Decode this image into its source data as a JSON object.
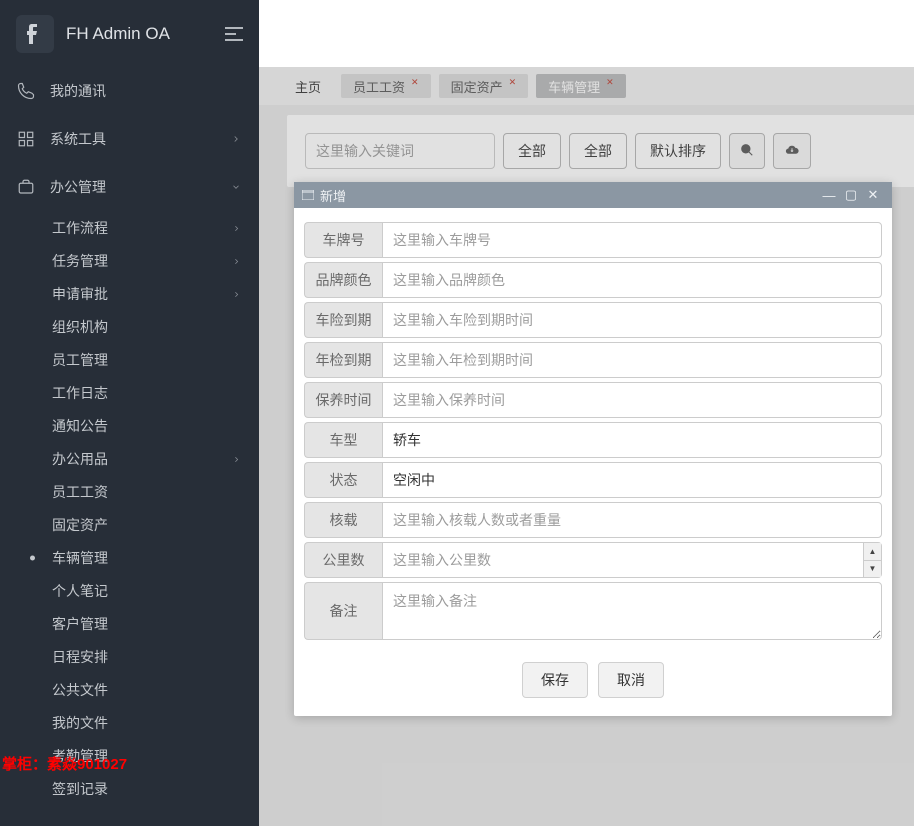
{
  "header": {
    "title": "FH Admin OA"
  },
  "sidebar": {
    "top": [
      {
        "icon": "phone",
        "label": "我的通讯",
        "expandable": false
      },
      {
        "icon": "grid",
        "label": "系统工具",
        "expandable": true,
        "expanded": false
      },
      {
        "icon": "briefcase",
        "label": "办公管理",
        "expandable": true,
        "expanded": true
      }
    ],
    "sub": [
      {
        "label": "工作流程",
        "expandable": true
      },
      {
        "label": "任务管理",
        "expandable": true
      },
      {
        "label": "申请审批",
        "expandable": true
      },
      {
        "label": "组织机构"
      },
      {
        "label": "员工管理"
      },
      {
        "label": "工作日志"
      },
      {
        "label": "通知公告"
      },
      {
        "label": "办公用品",
        "expandable": true
      },
      {
        "label": "员工工资"
      },
      {
        "label": "固定资产"
      },
      {
        "label": "车辆管理",
        "active": true
      },
      {
        "label": "个人笔记"
      },
      {
        "label": "客户管理"
      },
      {
        "label": "日程安排"
      },
      {
        "label": "公共文件"
      },
      {
        "label": "我的文件"
      },
      {
        "label": "考勤管理"
      },
      {
        "label": "签到记录"
      }
    ]
  },
  "watermark": "掌柜：素焱901027",
  "tabs": {
    "home": "主页",
    "items": [
      {
        "label": "员工工资"
      },
      {
        "label": "固定资产"
      },
      {
        "label": "车辆管理",
        "active": true
      }
    ]
  },
  "toolbar": {
    "keyword_placeholder": "这里输入关键词",
    "filter1": "全部",
    "filter2": "全部",
    "sort": "默认排序"
  },
  "dialog": {
    "title": "新增",
    "fields": {
      "plate": {
        "label": "车牌号",
        "placeholder": "这里输入车牌号"
      },
      "brandcol": {
        "label": "品牌颜色",
        "placeholder": "这里输入品牌颜色"
      },
      "insur": {
        "label": "车险到期",
        "placeholder": "这里输入车险到期时间"
      },
      "inspect": {
        "label": "年检到期",
        "placeholder": "这里输入年检到期时间"
      },
      "maint": {
        "label": "保养时间",
        "placeholder": "这里输入保养时间"
      },
      "type": {
        "label": "车型",
        "value": "轿车"
      },
      "status": {
        "label": "状态",
        "value": "空闲中"
      },
      "capacity": {
        "label": "核载",
        "placeholder": "这里输入核载人数或者重量"
      },
      "km": {
        "label": "公里数",
        "placeholder": "这里输入公里数"
      },
      "remark": {
        "label": "备注",
        "placeholder": "这里输入备注"
      }
    },
    "buttons": {
      "save": "保存",
      "cancel": "取消"
    }
  }
}
